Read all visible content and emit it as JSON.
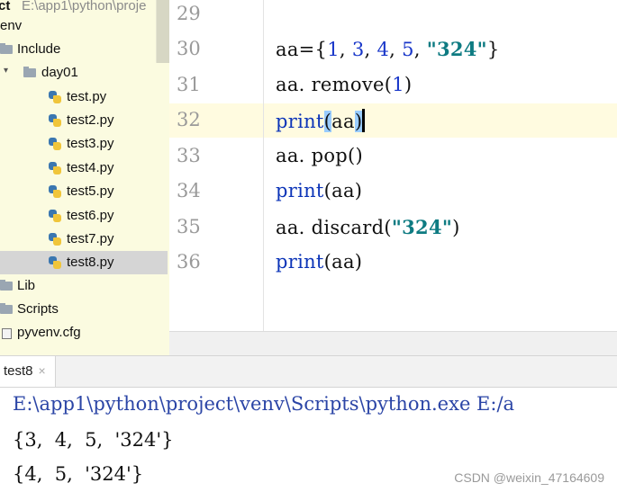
{
  "project_tree": {
    "root_path": "E:\\app1\\python\\proje",
    "venv_label": "env",
    "include_label": "Include",
    "day01_label": "day01",
    "files": [
      {
        "label": "test.py",
        "selected": false
      },
      {
        "label": "test2.py",
        "selected": false
      },
      {
        "label": "test3.py",
        "selected": false
      },
      {
        "label": "test4.py",
        "selected": false
      },
      {
        "label": "test5.py",
        "selected": false
      },
      {
        "label": "test6.py",
        "selected": false
      },
      {
        "label": "test7.py",
        "selected": false
      },
      {
        "label": "test8.py",
        "selected": true
      }
    ],
    "lib_label": "Lib",
    "scripts_label": "Scripts",
    "cfg_label": "pyvenv.cfg"
  },
  "editor": {
    "line_numbers": [
      "29",
      "30",
      "31",
      "32",
      "33",
      "34",
      "35",
      "36"
    ],
    "current_line": "32"
  },
  "run_panel": {
    "tab_label": "test8",
    "close_glyph": "×",
    "command": "E:\\app1\\python\\project\\venv\\Scripts\\python.exe E:/a",
    "output": [
      "{3,  4,  5,  '324'}",
      "{4,  5,  '324'}"
    ]
  },
  "watermark": "CSDN @weixin_47164609",
  "colors": {
    "tree_bg": "#fbfbe0",
    "current_line_bg": "#fffbe0",
    "keyword": "#0d35b8",
    "string": "#0e7b82",
    "bracket_match": "#99ccff"
  }
}
